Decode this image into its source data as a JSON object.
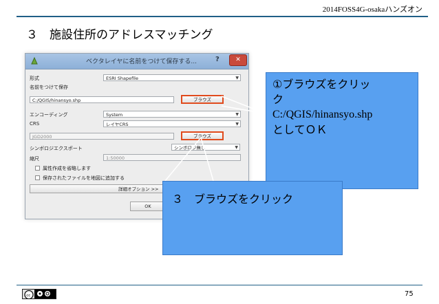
{
  "header": {
    "event": "2014FOSS4G-osakaハンズオン"
  },
  "slide": {
    "title": "３　施設住所のアドレスマッチング",
    "page_number": "75"
  },
  "dialog": {
    "title": "ベクタレイヤに名前をつけて保存する...",
    "help": "?",
    "close": "✕",
    "format_label": "形式",
    "format_value": "ESRI Shapefile",
    "saveas_label": "名前をつけて保存",
    "path_value": "C:/QGIS/hinansyo.shp",
    "browse_label": "ブラウズ",
    "encoding_label": "エンコーディング",
    "encoding_value": "System",
    "crs_label": "CRS",
    "crs_value": "レイヤCRS",
    "crs_field_value": "JGD2000",
    "symbology_label": "シンボロジエクスポート",
    "symbology_value": "シンボロジ無し",
    "scale_label": "縮尺",
    "scale_value": "1:50000",
    "skip_attr_label": "属性作成を省略します",
    "add_to_map_label": "保存されたファイルを地図に追加する",
    "advanced_label": "詳細オプション >>",
    "ok_label": "OK"
  },
  "callouts": {
    "first_line1": "①ブラウズをクリッ",
    "first_line2": "ク",
    "first_line3": "C:/QGIS/hinansyo.shp",
    "first_line4": "としてＯＫ",
    "second": "３　ブラウズをクリック"
  },
  "colors": {
    "callout": "#58a0f0",
    "highlight": "#e04a1c",
    "rule": "#1f5f86"
  }
}
